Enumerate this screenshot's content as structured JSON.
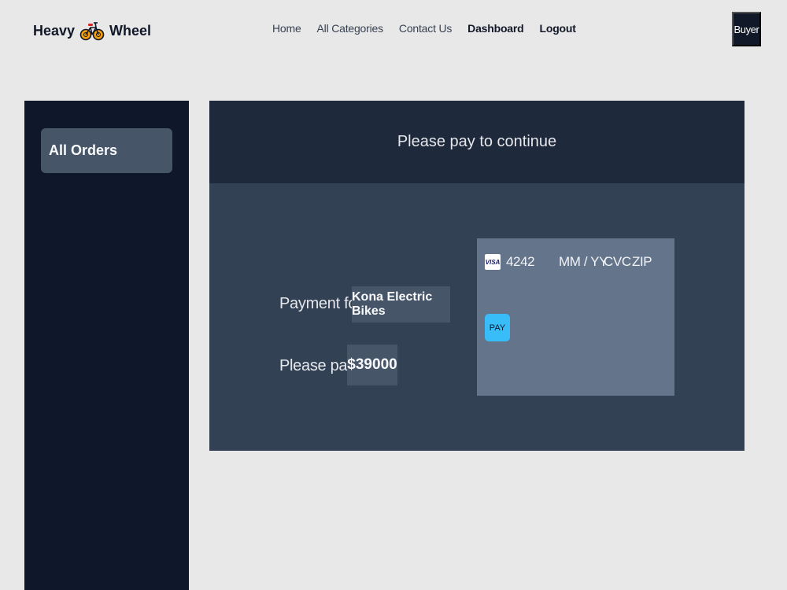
{
  "brand": {
    "word1": "Heavy",
    "word2": "Wheel",
    "icon": "bicycle-icon"
  },
  "nav": {
    "home": "Home",
    "categories": "All Categories",
    "contact": "Contact Us",
    "dashboard": "Dashboard",
    "logout": "Logout",
    "role": "Buyer"
  },
  "sidebar": {
    "items": [
      {
        "label": "All Orders"
      }
    ]
  },
  "payment": {
    "title": "Please pay to continue",
    "payment_for_label": "Payment for",
    "product": "Kona Electric Bikes",
    "please_pay_label": "Please pay",
    "amount": "$39000"
  },
  "card_form": {
    "brand_icon": "visa-icon",
    "brand_text": "VISA",
    "card_number": "4242",
    "expiry": "MM / YY",
    "cvc": "CVC",
    "zip": "ZIP",
    "pay_label": "PAY"
  },
  "colors": {
    "page_bg": "#e9e8e9",
    "sidebar_bg": "#0f172a",
    "panel_header_bg": "#1e293b",
    "panel_body_bg": "#334155",
    "card_bg": "#64748b",
    "pay_button": "#38bdf8"
  }
}
